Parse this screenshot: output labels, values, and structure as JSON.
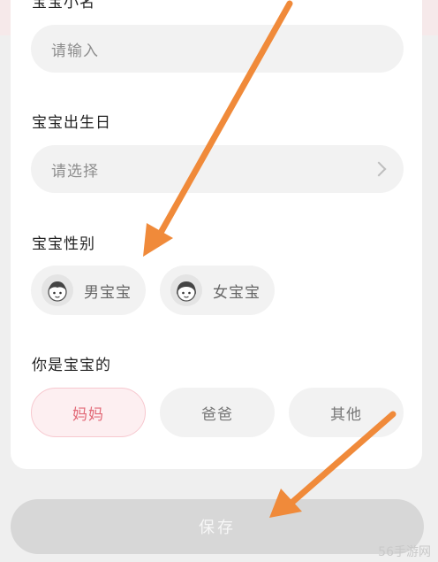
{
  "form": {
    "nickname_label": "宝宝小名",
    "nickname_placeholder": "请输入",
    "birthday_label": "宝宝出生日",
    "birthday_placeholder": "请选择",
    "gender_label": "宝宝性别",
    "gender_options": [
      "男宝宝",
      "女宝宝"
    ],
    "role_label": "你是宝宝的",
    "role_options": [
      "妈妈",
      "爸爸",
      "其他"
    ],
    "selected_role": "妈妈"
  },
  "save_label": "保存",
  "watermark": "56手游网",
  "colors": {
    "accent_pink": "#e26a78",
    "selected_bg": "#fdeff1",
    "annotation_arrow": "#f08a3a",
    "save_disabled": "#d7d7d7"
  },
  "icons": [
    "chevron-right-icon",
    "boy-avatar-icon",
    "girl-avatar-icon"
  ]
}
